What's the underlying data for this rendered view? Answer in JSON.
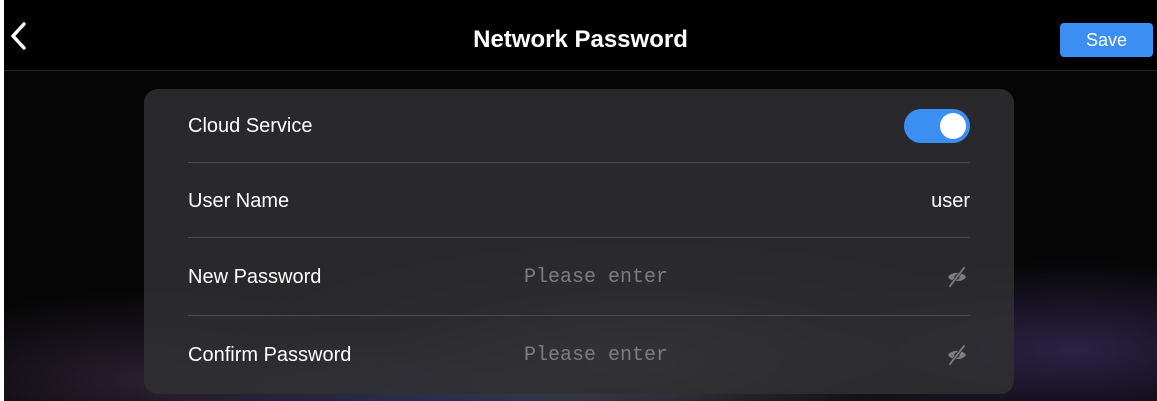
{
  "header": {
    "title": "Network Password",
    "save_label": "Save",
    "back_icon": "chevron-left-icon"
  },
  "settings": {
    "cloud_service": {
      "label": "Cloud Service",
      "enabled": true
    },
    "user_name": {
      "label": "User Name",
      "value": "user"
    },
    "new_password": {
      "label": "New Password",
      "value": "",
      "placeholder": "Please enter",
      "visibility_icon": "eye-slash-icon"
    },
    "confirm_password": {
      "label": "Confirm Password",
      "value": "",
      "placeholder": "Please enter",
      "visibility_icon": "eye-slash-icon"
    }
  },
  "colors": {
    "accent": "#3b8ff2",
    "background": "#050505",
    "card": "#303032",
    "text": "#ffffff",
    "placeholder": "#7d7d80"
  }
}
